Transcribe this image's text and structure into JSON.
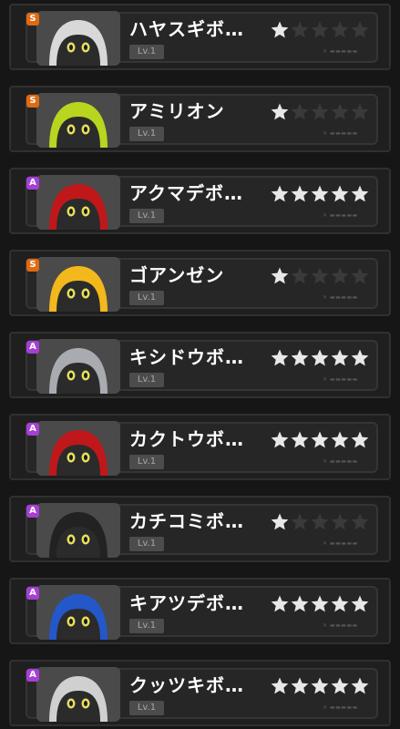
{
  "colors": {
    "rank_S": "#e06a12",
    "rank_A": "#a63fd6",
    "star_filled": "#e8e8e8",
    "star_empty": "#3a3a3a"
  },
  "cards": [
    {
      "rank": "S",
      "name": "ハヤスギボ…",
      "level": "Lv.1",
      "stars": 1,
      "portrait": "goggles-robot",
      "portrait_color": "#d8d8d8"
    },
    {
      "rank": "S",
      "name": "アミリオン",
      "level": "Lv.1",
      "stars": 1,
      "portrait": "green-rabbit-robot",
      "portrait_color": "#b7d61f"
    },
    {
      "rank": "A",
      "name": "アクマデボ…",
      "level": "Lv.1",
      "stars": 5,
      "portrait": "red-devil-robot",
      "portrait_color": "#c0181a"
    },
    {
      "rank": "S",
      "name": "ゴアンゼン",
      "level": "Lv.1",
      "stars": 1,
      "portrait": "hardhat-robot",
      "portrait_color": "#f2b81c"
    },
    {
      "rank": "A",
      "name": "キシドウボ…",
      "level": "Lv.1",
      "stars": 5,
      "portrait": "knight-robot",
      "portrait_color": "#a8acb0"
    },
    {
      "rank": "A",
      "name": "カクトウボ…",
      "level": "Lv.1",
      "stars": 5,
      "portrait": "fighter-robot",
      "portrait_color": "#c0181a"
    },
    {
      "rank": "A",
      "name": "カチコミボ…",
      "level": "Lv.1",
      "stars": 1,
      "portrait": "samurai-robot",
      "portrait_color": "#222222"
    },
    {
      "rank": "A",
      "name": "キアツデボ…",
      "level": "Lv.1",
      "stars": 5,
      "portrait": "blue-robot",
      "portrait_color": "#2457c8"
    },
    {
      "rank": "A",
      "name": "クッツキボ…",
      "level": "Lv.1",
      "stars": 5,
      "portrait": "magnet-robot",
      "portrait_color": "#d0d0d0"
    }
  ]
}
